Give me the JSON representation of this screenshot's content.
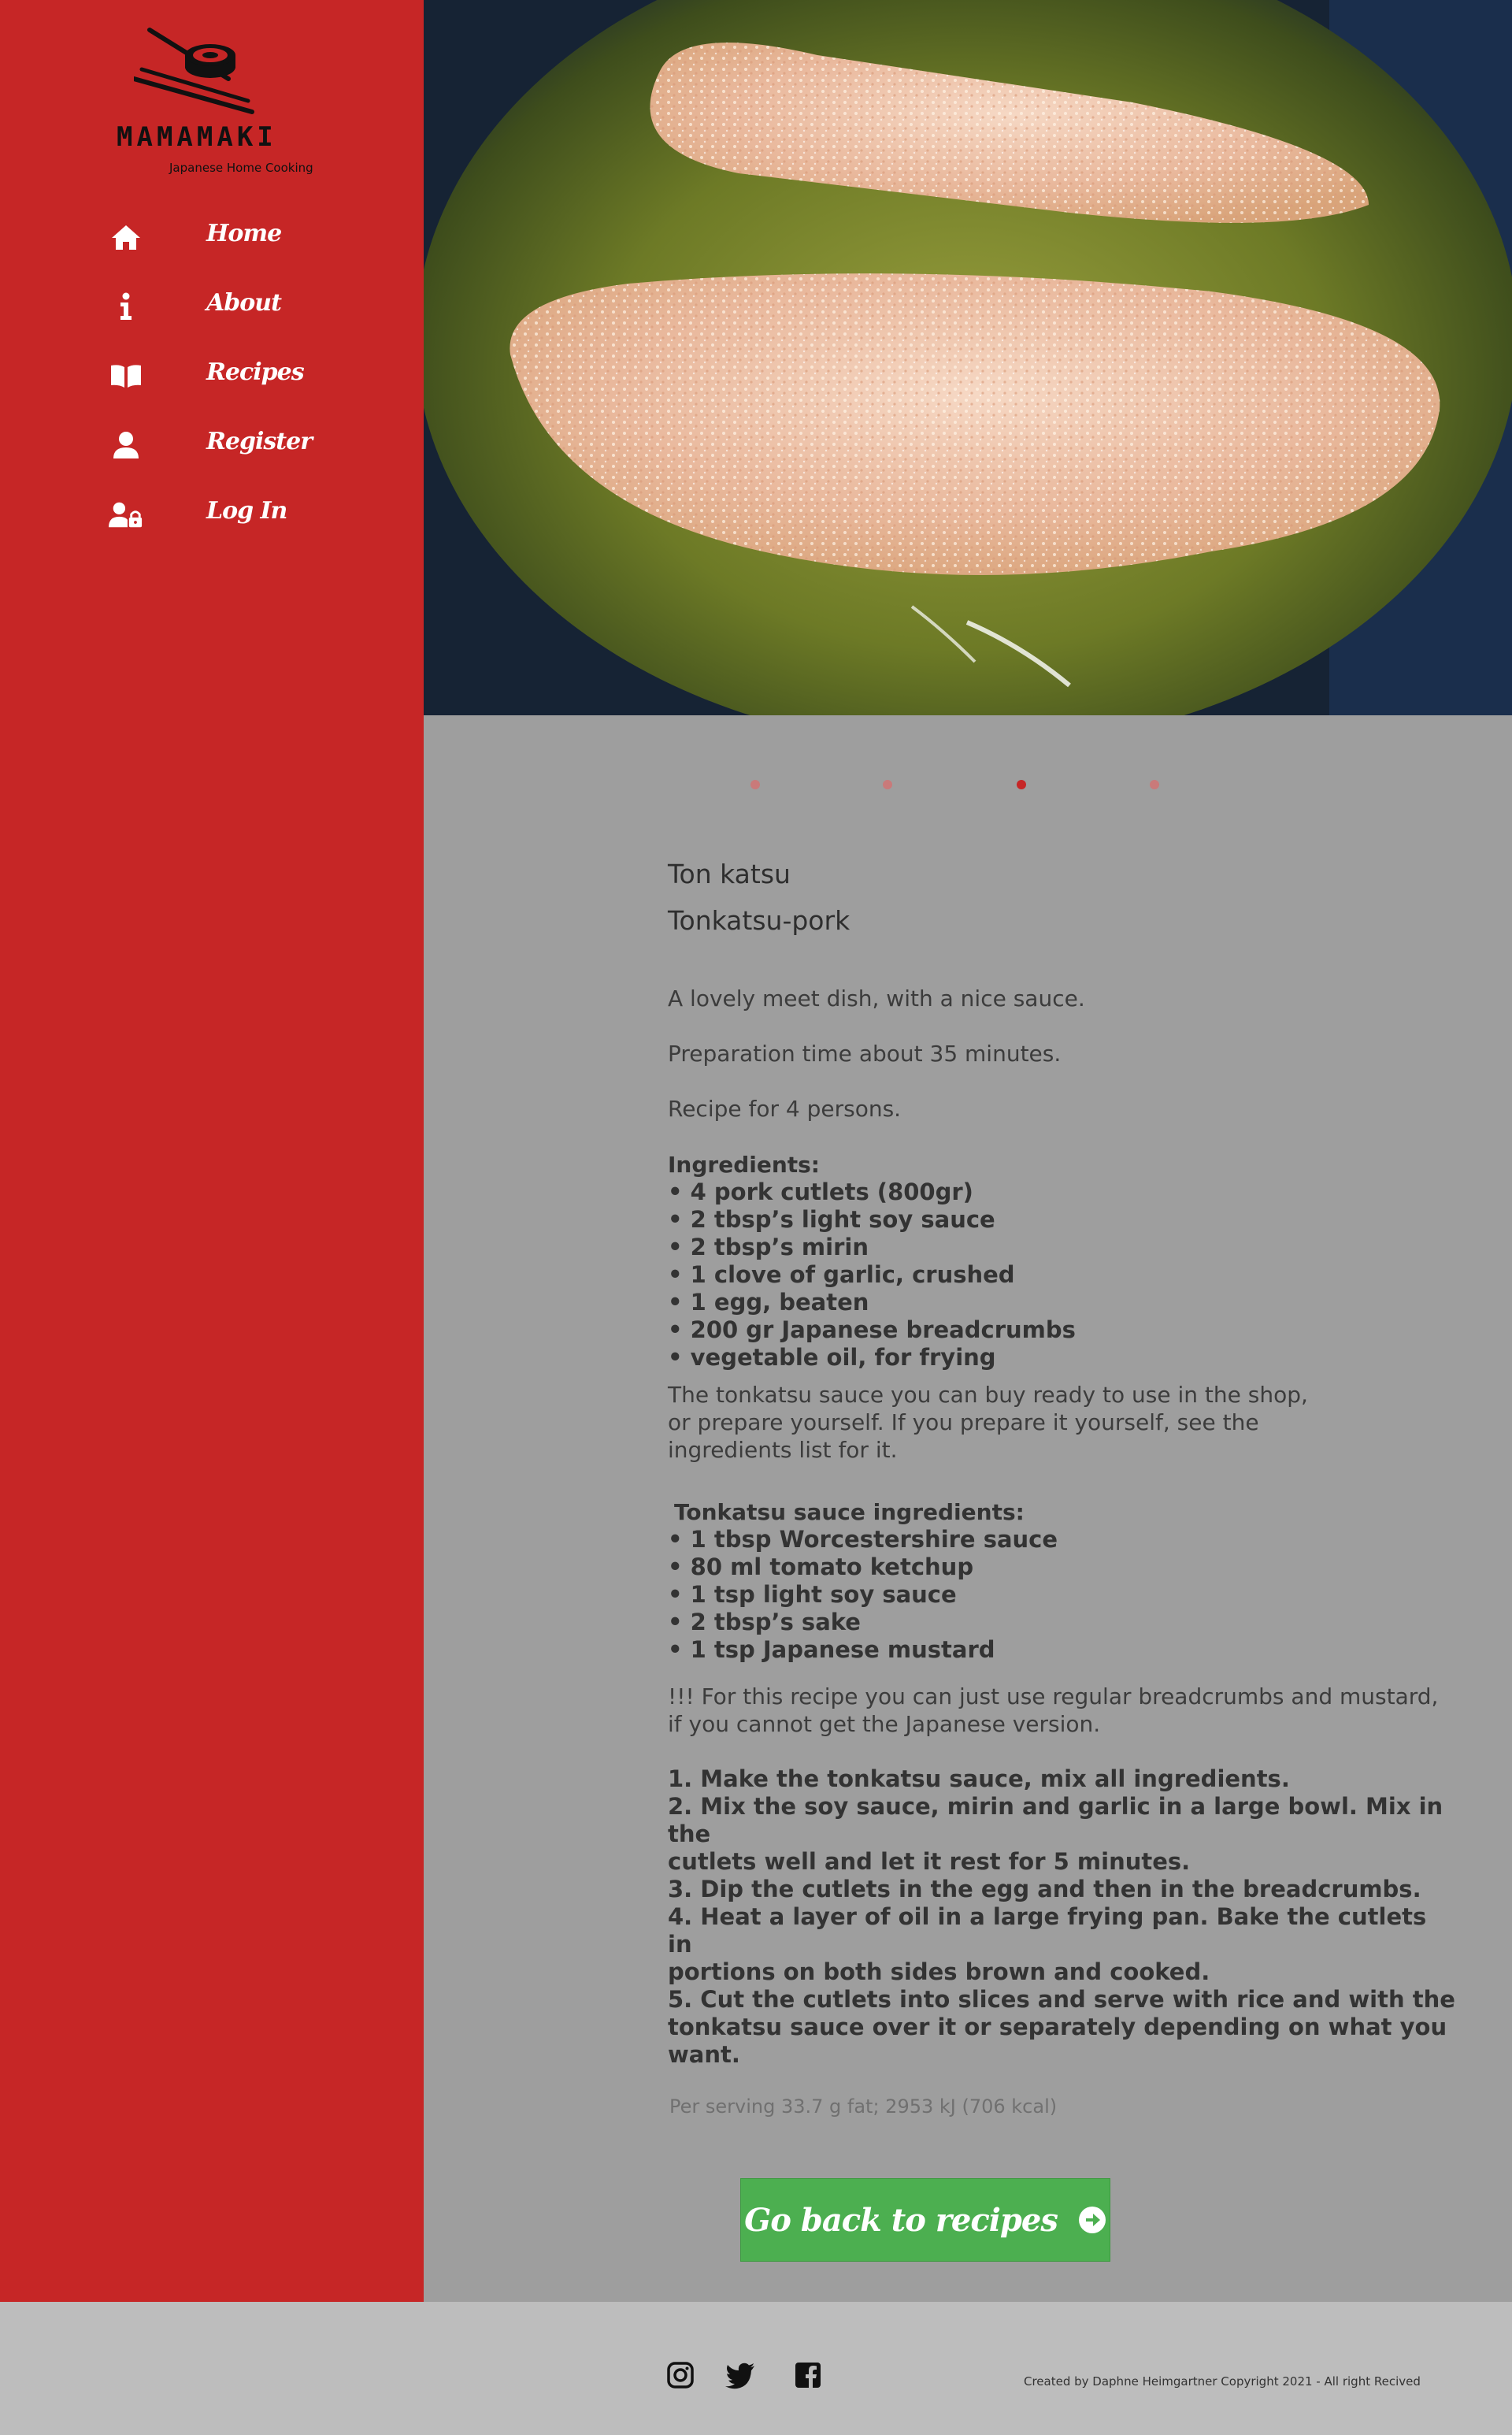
{
  "brand": {
    "name": "MAMAMAKI",
    "tagline": "Japanese Home Cooking"
  },
  "nav": {
    "items": [
      {
        "label": "Home",
        "icon": "home-icon"
      },
      {
        "label": "About",
        "icon": "info-icon"
      },
      {
        "label": "Recipes",
        "icon": "book-icon"
      },
      {
        "label": "Register",
        "icon": "user-icon"
      },
      {
        "label": "Log In",
        "icon": "user-lock-icon"
      }
    ]
  },
  "carousel": {
    "slide_count": 4,
    "active_index": 3
  },
  "recipe": {
    "title": "Ton katsu",
    "subtitle": "Tonkatsu-pork",
    "description": "A lovely meet dish, with a nice sauce.",
    "prep_time": "Preparation time about 35 minutes.",
    "servings": "Recipe for 4 persons.",
    "ingredients_heading": "Ingredients:",
    "ingredients": [
      "4 pork cutlets (800gr)",
      "2 tbsp’s light soy sauce",
      "2 tbsp’s mirin",
      "1 clove of garlic, crushed",
      "1 egg, beaten",
      "200 gr Japanese breadcrumbs",
      "vegetable oil, for frying"
    ],
    "sauce_note": [
      "The tonkatsu sauce you can buy ready to use in the shop,",
      "or prepare yourself. If you prepare it yourself, see the",
      "ingredients list for it."
    ],
    "sauce_heading": "Tonkatsu sauce ingredients:",
    "sauce_ingredients": [
      "1 tbsp Worcestershire sauce",
      "80 ml tomato ketchup",
      "1 tsp light soy sauce",
      "2 tbsp’s sake",
      "1 tsp Japanese mustard"
    ],
    "tip": [
      "!!! For this recipe you can just use regular breadcrumbs and mustard,",
      "if you cannot get the Japanese version."
    ],
    "steps": [
      "1. Make the tonkatsu sauce, mix all ingredients.",
      "2. Mix the soy sauce, mirin and garlic in a large bowl. Mix in the",
      "cutlets well and let it rest for 5 minutes.",
      "3. Dip the cutlets in the egg and then in the breadcrumbs.",
      "4. Heat a layer of oil in a large frying pan. Bake the cutlets in",
      "portions on both sides brown and cooked.",
      "5. Cut the cutlets into slices and serve with rice and with the",
      "tonkatsu sauce over it or separately depending on what you want."
    ],
    "nutrition": "Per serving 33.7 g fat; 2953 kJ (706 kcal)"
  },
  "back_button": {
    "label": "Go back to recipes"
  },
  "footer": {
    "social": [
      "instagram-icon",
      "twitter-icon",
      "facebook-icon"
    ],
    "copyright": "Created by Daphne Heimgartner Copyright 2021 - All right Recived"
  },
  "colors": {
    "sidebar": "#c62626",
    "content_bg": "#9e9e9e",
    "footer_bg": "#bdbdbd",
    "button": "#4caf50"
  }
}
